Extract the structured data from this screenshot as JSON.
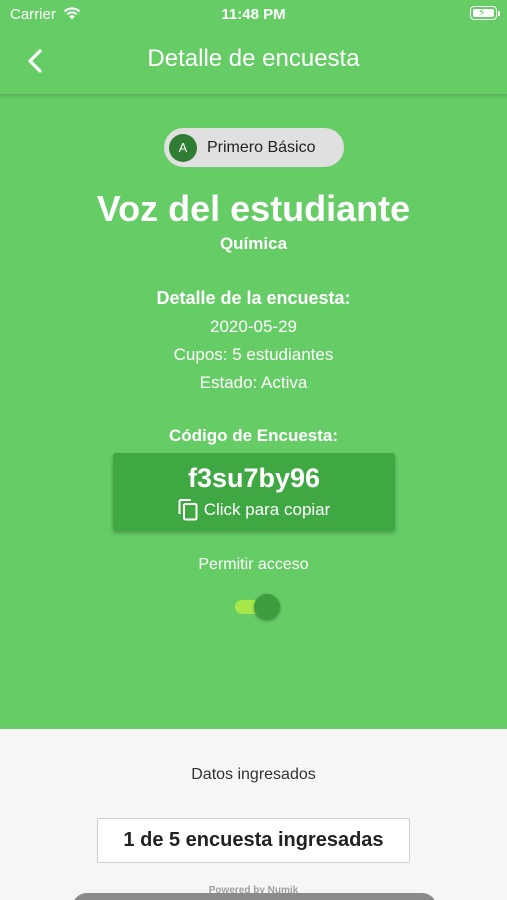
{
  "status_bar": {
    "carrier": "Carrier",
    "time": "11:48 PM",
    "icons": [
      "wifi-icon",
      "battery-charging-icon"
    ]
  },
  "nav": {
    "title": "Detalle de encuesta",
    "back_icon": "chevron-left-icon"
  },
  "course_chip": {
    "avatar_letter": "A",
    "label": "Primero Básico"
  },
  "survey": {
    "title": "Voz del estudiante",
    "subject": "Química",
    "detail_heading": "Detalle de la encuesta:",
    "date": "2020-05-29",
    "slots": "Cupos: 5 estudiantes",
    "status": "Estado: Activa"
  },
  "code": {
    "heading": "Código de Encuesta:",
    "value": "f3su7by96",
    "copy_label": "Click para copiar",
    "copy_icon": "copy-icon"
  },
  "access": {
    "label": "Permitir acceso",
    "enabled": true
  },
  "results": {
    "label": "Datos ingresados",
    "count_text": "1 de 5 encuesta ingresadas",
    "powered_by": "Powered by Numik"
  },
  "colors": {
    "primary": "#66cc66",
    "code_card": "#3fa843",
    "avatar": "#2e7d32",
    "toggle_track": "#a6e84b",
    "toggle_knob": "#3d9e3f",
    "background": "#f6f6f6"
  }
}
